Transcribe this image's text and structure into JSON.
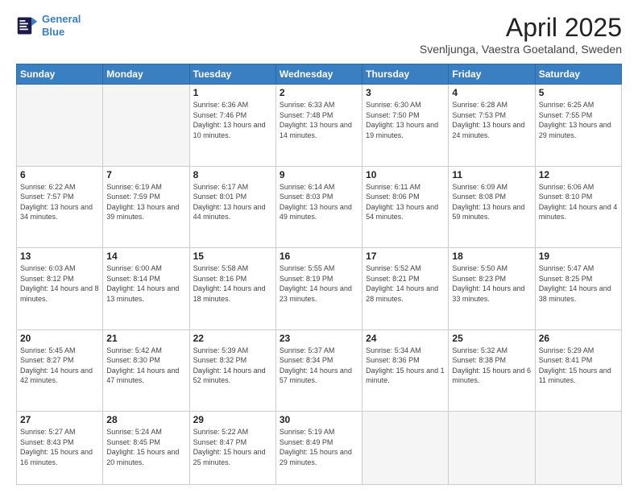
{
  "header": {
    "logo_line1": "General",
    "logo_line2": "Blue",
    "month": "April 2025",
    "location": "Svenljunga, Vaestra Goetaland, Sweden"
  },
  "days_of_week": [
    "Sunday",
    "Monday",
    "Tuesday",
    "Wednesday",
    "Thursday",
    "Friday",
    "Saturday"
  ],
  "weeks": [
    [
      {
        "num": "",
        "sunrise": "",
        "sunset": "",
        "daylight": ""
      },
      {
        "num": "",
        "sunrise": "",
        "sunset": "",
        "daylight": ""
      },
      {
        "num": "1",
        "sunrise": "Sunrise: 6:36 AM",
        "sunset": "Sunset: 7:46 PM",
        "daylight": "Daylight: 13 hours and 10 minutes."
      },
      {
        "num": "2",
        "sunrise": "Sunrise: 6:33 AM",
        "sunset": "Sunset: 7:48 PM",
        "daylight": "Daylight: 13 hours and 14 minutes."
      },
      {
        "num": "3",
        "sunrise": "Sunrise: 6:30 AM",
        "sunset": "Sunset: 7:50 PM",
        "daylight": "Daylight: 13 hours and 19 minutes."
      },
      {
        "num": "4",
        "sunrise": "Sunrise: 6:28 AM",
        "sunset": "Sunset: 7:53 PM",
        "daylight": "Daylight: 13 hours and 24 minutes."
      },
      {
        "num": "5",
        "sunrise": "Sunrise: 6:25 AM",
        "sunset": "Sunset: 7:55 PM",
        "daylight": "Daylight: 13 hours and 29 minutes."
      }
    ],
    [
      {
        "num": "6",
        "sunrise": "Sunrise: 6:22 AM",
        "sunset": "Sunset: 7:57 PM",
        "daylight": "Daylight: 13 hours and 34 minutes."
      },
      {
        "num": "7",
        "sunrise": "Sunrise: 6:19 AM",
        "sunset": "Sunset: 7:59 PM",
        "daylight": "Daylight: 13 hours and 39 minutes."
      },
      {
        "num": "8",
        "sunrise": "Sunrise: 6:17 AM",
        "sunset": "Sunset: 8:01 PM",
        "daylight": "Daylight: 13 hours and 44 minutes."
      },
      {
        "num": "9",
        "sunrise": "Sunrise: 6:14 AM",
        "sunset": "Sunset: 8:03 PM",
        "daylight": "Daylight: 13 hours and 49 minutes."
      },
      {
        "num": "10",
        "sunrise": "Sunrise: 6:11 AM",
        "sunset": "Sunset: 8:06 PM",
        "daylight": "Daylight: 13 hours and 54 minutes."
      },
      {
        "num": "11",
        "sunrise": "Sunrise: 6:09 AM",
        "sunset": "Sunset: 8:08 PM",
        "daylight": "Daylight: 13 hours and 59 minutes."
      },
      {
        "num": "12",
        "sunrise": "Sunrise: 6:06 AM",
        "sunset": "Sunset: 8:10 PM",
        "daylight": "Daylight: 14 hours and 4 minutes."
      }
    ],
    [
      {
        "num": "13",
        "sunrise": "Sunrise: 6:03 AM",
        "sunset": "Sunset: 8:12 PM",
        "daylight": "Daylight: 14 hours and 8 minutes."
      },
      {
        "num": "14",
        "sunrise": "Sunrise: 6:00 AM",
        "sunset": "Sunset: 8:14 PM",
        "daylight": "Daylight: 14 hours and 13 minutes."
      },
      {
        "num": "15",
        "sunrise": "Sunrise: 5:58 AM",
        "sunset": "Sunset: 8:16 PM",
        "daylight": "Daylight: 14 hours and 18 minutes."
      },
      {
        "num": "16",
        "sunrise": "Sunrise: 5:55 AM",
        "sunset": "Sunset: 8:19 PM",
        "daylight": "Daylight: 14 hours and 23 minutes."
      },
      {
        "num": "17",
        "sunrise": "Sunrise: 5:52 AM",
        "sunset": "Sunset: 8:21 PM",
        "daylight": "Daylight: 14 hours and 28 minutes."
      },
      {
        "num": "18",
        "sunrise": "Sunrise: 5:50 AM",
        "sunset": "Sunset: 8:23 PM",
        "daylight": "Daylight: 14 hours and 33 minutes."
      },
      {
        "num": "19",
        "sunrise": "Sunrise: 5:47 AM",
        "sunset": "Sunset: 8:25 PM",
        "daylight": "Daylight: 14 hours and 38 minutes."
      }
    ],
    [
      {
        "num": "20",
        "sunrise": "Sunrise: 5:45 AM",
        "sunset": "Sunset: 8:27 PM",
        "daylight": "Daylight: 14 hours and 42 minutes."
      },
      {
        "num": "21",
        "sunrise": "Sunrise: 5:42 AM",
        "sunset": "Sunset: 8:30 PM",
        "daylight": "Daylight: 14 hours and 47 minutes."
      },
      {
        "num": "22",
        "sunrise": "Sunrise: 5:39 AM",
        "sunset": "Sunset: 8:32 PM",
        "daylight": "Daylight: 14 hours and 52 minutes."
      },
      {
        "num": "23",
        "sunrise": "Sunrise: 5:37 AM",
        "sunset": "Sunset: 8:34 PM",
        "daylight": "Daylight: 14 hours and 57 minutes."
      },
      {
        "num": "24",
        "sunrise": "Sunrise: 5:34 AM",
        "sunset": "Sunset: 8:36 PM",
        "daylight": "Daylight: 15 hours and 1 minute."
      },
      {
        "num": "25",
        "sunrise": "Sunrise: 5:32 AM",
        "sunset": "Sunset: 8:38 PM",
        "daylight": "Daylight: 15 hours and 6 minutes."
      },
      {
        "num": "26",
        "sunrise": "Sunrise: 5:29 AM",
        "sunset": "Sunset: 8:41 PM",
        "daylight": "Daylight: 15 hours and 11 minutes."
      }
    ],
    [
      {
        "num": "27",
        "sunrise": "Sunrise: 5:27 AM",
        "sunset": "Sunset: 8:43 PM",
        "daylight": "Daylight: 15 hours and 16 minutes."
      },
      {
        "num": "28",
        "sunrise": "Sunrise: 5:24 AM",
        "sunset": "Sunset: 8:45 PM",
        "daylight": "Daylight: 15 hours and 20 minutes."
      },
      {
        "num": "29",
        "sunrise": "Sunrise: 5:22 AM",
        "sunset": "Sunset: 8:47 PM",
        "daylight": "Daylight: 15 hours and 25 minutes."
      },
      {
        "num": "30",
        "sunrise": "Sunrise: 5:19 AM",
        "sunset": "Sunset: 8:49 PM",
        "daylight": "Daylight: 15 hours and 29 minutes."
      },
      {
        "num": "",
        "sunrise": "",
        "sunset": "",
        "daylight": ""
      },
      {
        "num": "",
        "sunrise": "",
        "sunset": "",
        "daylight": ""
      },
      {
        "num": "",
        "sunrise": "",
        "sunset": "",
        "daylight": ""
      }
    ]
  ]
}
